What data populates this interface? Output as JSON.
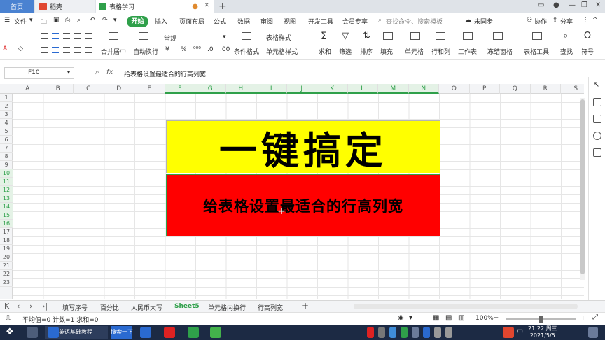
{
  "titlebar": {
    "tabs": [
      {
        "label": "首页"
      },
      {
        "label": "稻壳"
      },
      {
        "label": "表格学习"
      }
    ]
  },
  "menubar": {
    "file": "文件",
    "start": "开始",
    "items": [
      "插入",
      "页面布局",
      "公式",
      "数据",
      "审阅",
      "视图",
      "开发工具",
      "会员专享"
    ],
    "search_placeholder": "查找命令、搜索模板",
    "sync": "未同步",
    "collab": "协作",
    "share": "分享"
  },
  "ribbon": {
    "merge_center": "合并居中",
    "wrap": "自动换行",
    "number_format": "常规",
    "cond_format": "条件格式",
    "table_style": "表格样式",
    "cell_style": "单元格样式",
    "sum": "求和",
    "filter": "筛选",
    "sort": "排序",
    "fill": "填充",
    "cell": "单元格",
    "row_col": "行和列",
    "sheet": "工作表",
    "freeze": "冻结窗格",
    "table_tools": "表格工具",
    "find": "查找",
    "symbol": "符号"
  },
  "formulabar": {
    "cell_ref": "F10",
    "content": "给表格设置最适合的行高列宽"
  },
  "grid": {
    "columns": [
      "A",
      "B",
      "C",
      "D",
      "E",
      "F",
      "G",
      "H",
      "I",
      "J",
      "K",
      "L",
      "M",
      "N",
      "O",
      "P",
      "Q",
      "R",
      "S"
    ],
    "rows": [
      "1",
      "2",
      "3",
      "4",
      "5",
      "6",
      "7",
      "8",
      "9",
      "10",
      "11",
      "12",
      "13",
      "14",
      "15",
      "16",
      "17",
      "18",
      "19",
      "20",
      "21",
      "22",
      "23"
    ],
    "headline": "一键搞定",
    "subline": "给表格设置最适合的行高列宽",
    "colors": {
      "yellow": "#ffff00",
      "red": "#ff0000",
      "accent": "#2fa04a"
    }
  },
  "sheets": {
    "tabs": [
      "填写序号",
      "百分比",
      "人民币大写",
      "Sheet5",
      "单元格内换行",
      "行高列宽"
    ],
    "active": "Sheet5"
  },
  "statusbar": {
    "summary": "平均值=0  计数=1  求和=0",
    "zoom": "100%"
  },
  "taskbar": {
    "browser_tab": "英语基础教程",
    "search_btn": "搜索一下",
    "ime": "中",
    "time": "21:22 周三",
    "date": "2021/5/5"
  }
}
